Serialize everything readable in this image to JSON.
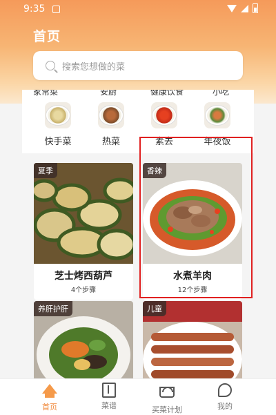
{
  "status_bar": {
    "time": "9:35"
  },
  "header": {
    "title": "首页"
  },
  "search": {
    "placeholder": "搜索您想做的菜"
  },
  "top_cut_labels": [
    "家常菜",
    "安厨",
    "健康饮食",
    "小吃"
  ],
  "categories": [
    {
      "label": "快手菜",
      "icon": "salad-dish-icon"
    },
    {
      "label": "热菜",
      "icon": "hot-dish-icon"
    },
    {
      "label": "素去",
      "icon": "pepper-dish-icon"
    },
    {
      "label": "年夜饭",
      "icon": "festive-dish-icon"
    }
  ],
  "recipes": [
    {
      "tag": "夏季",
      "title": "芝士烤西葫芦",
      "steps": "4个步骤"
    },
    {
      "tag": "香辣",
      "title": "水煮羊肉",
      "steps": "12个步骤"
    },
    {
      "tag": "养肝护肝",
      "title": "",
      "steps": ""
    },
    {
      "tag": "儿童",
      "title": "",
      "steps": ""
    }
  ],
  "bottom_nav": [
    {
      "label": "首页",
      "active": true
    },
    {
      "label": "菜谱",
      "active": false
    },
    {
      "label": "买菜计划",
      "active": false
    },
    {
      "label": "我的",
      "active": false
    }
  ],
  "colors": {
    "accent": "#f08a3c",
    "highlight": "#e02020"
  }
}
